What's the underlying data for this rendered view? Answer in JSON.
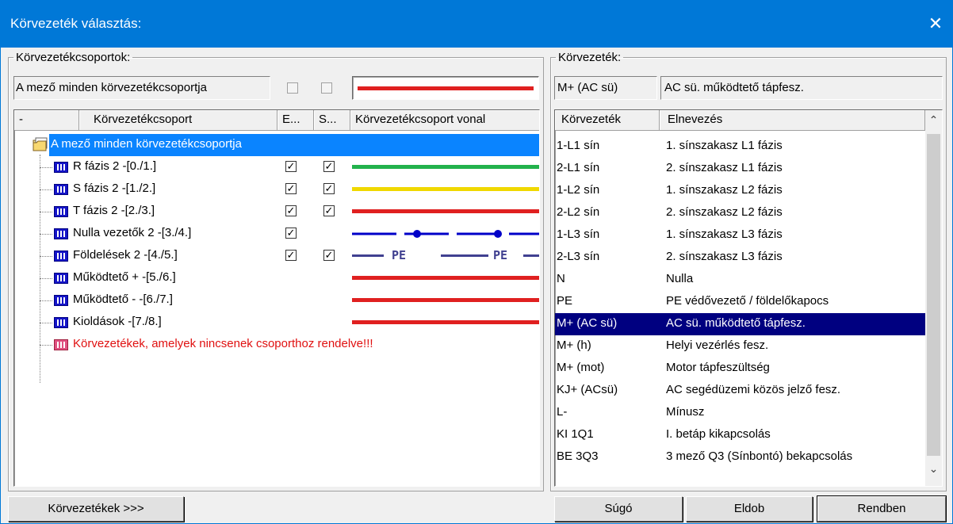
{
  "window": {
    "title": "Körvezeték választás:",
    "close_glyph": "✕"
  },
  "left": {
    "legend": "Körvezetékcsoportok:",
    "selected_group_text": "A mező minden körvezetékcsoportja",
    "columns": [
      "-",
      "Körvezetékcsoport",
      "E...",
      "S...",
      "Körvezetékcsoport vonal"
    ],
    "root_label": "A mező minden körvezetékcsoportja",
    "rows": [
      {
        "label": "R fázis 2 -[0./1.]",
        "e": true,
        "s": true,
        "line": "green"
      },
      {
        "label": "S fázis 2 -[1./2.]",
        "e": true,
        "s": true,
        "line": "yellow"
      },
      {
        "label": "T fázis 2 -[2./3.]",
        "e": true,
        "s": true,
        "line": "red"
      },
      {
        "label": "Nulla vezetők 2 -[3./4.]",
        "e": true,
        "s": false,
        "line": "dotblue"
      },
      {
        "label": "Földelések 2 -[4./5.]",
        "e": true,
        "s": true,
        "line": "pe"
      },
      {
        "label": "Működtető + -[5./6.]",
        "e": false,
        "s": false,
        "line": "red"
      },
      {
        "label": "Működtető - -[6./7.]",
        "e": false,
        "s": false,
        "line": "red"
      },
      {
        "label": "Kioldások -[7./8.]",
        "e": false,
        "s": false,
        "line": "red"
      }
    ],
    "ungrouped_label": "Körvezetékek, amelyek nincsenek csoporthoz rendelve!!!",
    "pe_text": "PE",
    "check_glyph": "✓"
  },
  "right": {
    "legend": "Körvezeték:",
    "selected_code": "M+ (AC sü)",
    "selected_name": "AC sü. működtető tápfesz.",
    "columns": [
      "Körvezeték",
      "Elnevezés"
    ],
    "rows": [
      {
        "code": "1-L1 sín",
        "name": "1. sínszakasz L1 fázis"
      },
      {
        "code": "2-L1 sín",
        "name": "2. sínszakasz L1 fázis"
      },
      {
        "code": "1-L2 sín",
        "name": "1. sínszakasz L2 fázis"
      },
      {
        "code": "2-L2 sín",
        "name": "2. sínszakasz L2 fázis"
      },
      {
        "code": "1-L3 sín",
        "name": "1. sínszakasz L3 fázis"
      },
      {
        "code": "2-L3 sín",
        "name": "2. sínszakasz L3 fázis"
      },
      {
        "code": "N",
        "name": "Nulla"
      },
      {
        "code": "PE",
        "name": "PE védővezető / földelőkapocs"
      },
      {
        "code": "M+ (AC sü)",
        "name": "AC sü. működtető tápfesz."
      },
      {
        "code": "M+ (h)",
        "name": "Helyi vezérlés fesz."
      },
      {
        "code": "M+ (mot)",
        "name": "Motor tápfeszültség"
      },
      {
        "code": "KJ+ (ACsü)",
        "name": "AC segédüzemi közös jelző fesz."
      },
      {
        "code": "L-",
        "name": "Mínusz"
      },
      {
        "code": "KI 1Q1",
        "name": "I. betáp kikapcsolás"
      },
      {
        "code": "BE 3Q3",
        "name": "3 mező Q3 (Sínbontó) bekapcsolás"
      }
    ],
    "selected_index": 8,
    "scroll_up": "⌃",
    "scroll_down": "⌄"
  },
  "buttons": {
    "korvezetekek": "Körvezetékek >>>",
    "sugo": "Súgó",
    "eldob": "Eldob",
    "rendben": "Rendben"
  },
  "colors": {
    "titlebar": "#0078d7",
    "selection": "#000080",
    "root_highlight": "#0a84ff",
    "green": "#22b24c",
    "yellow": "#f0d800",
    "red": "#e02020",
    "blue": "#0000c8",
    "pe": "#404090",
    "ungrouped_text": "#e01010"
  }
}
